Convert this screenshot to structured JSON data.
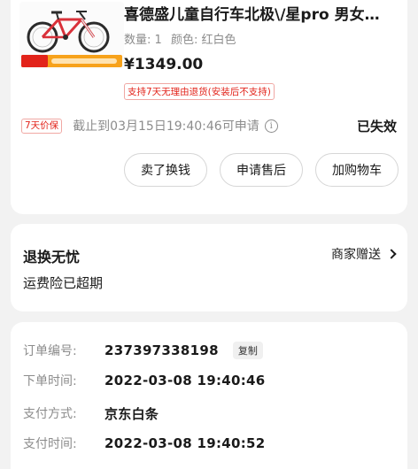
{
  "product": {
    "title": "喜德盛儿童自行车北极\\/星pro 男女…",
    "spec_qty": "数量: 1",
    "spec_color": "颜色: 红白色",
    "price": "¥1349.00",
    "return_policy": "支持7天无理由退货(安装后不支持)",
    "image_icon": "bicycle-image",
    "colors": {
      "frame": "#d9313a",
      "accent": "#e2231a"
    }
  },
  "protection": {
    "badge": "7天价保",
    "text": "截止到03月15日19:40:46可申请",
    "status": "已失效"
  },
  "actions": {
    "exchange": "卖了换钱",
    "after_sale": "申请售后",
    "add_cart": "加购物车"
  },
  "returns": {
    "title": "退换无忧",
    "subtitle": "运费险已超期",
    "merchant": "商家赠送"
  },
  "order": {
    "number_label": "订单编号:",
    "number": "237397338198",
    "copy": "复制",
    "time_label": "下单时间:",
    "time": "2022-03-08 19:40:46",
    "pay_method_label": "支付方式:",
    "pay_method": "京东白条",
    "pay_time_label": "支付时间:",
    "pay_time": "2022-03-08 19:40:52"
  }
}
